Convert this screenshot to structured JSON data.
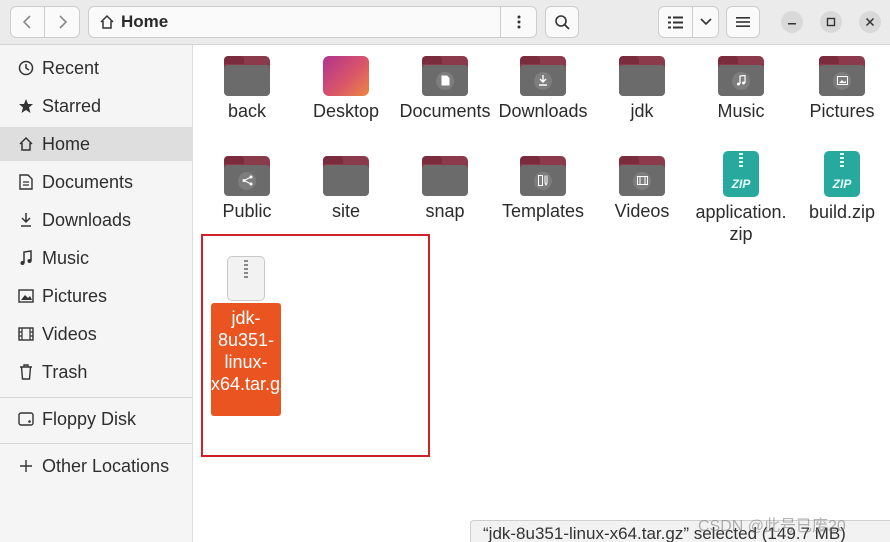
{
  "header": {
    "back_icon": "chevron-left-icon",
    "forward_icon": "chevron-right-icon",
    "path_icon": "home-icon",
    "path_label": "Home",
    "path_menu_icon": "vertical-dots-icon",
    "search_icon": "search-icon",
    "view_icon": "list-view-icon",
    "view_options_icon": "chevron-down-icon",
    "menu_icon": "hamburger-icon",
    "window_buttons": [
      "minimize-icon",
      "maximize-icon",
      "close-icon"
    ]
  },
  "sidebar": {
    "items": [
      {
        "label": "Recent",
        "icon": "clock-icon"
      },
      {
        "label": "Starred",
        "icon": "star-icon"
      },
      {
        "label": "Home",
        "icon": "home-icon",
        "selected": true
      },
      {
        "label": "Documents",
        "icon": "document-icon"
      },
      {
        "label": "Downloads",
        "icon": "download-icon"
      },
      {
        "label": "Music",
        "icon": "music-icon"
      },
      {
        "label": "Pictures",
        "icon": "picture-icon"
      },
      {
        "label": "Videos",
        "icon": "video-icon"
      },
      {
        "label": "Trash",
        "icon": "trash-icon"
      },
      {
        "label": "Floppy Disk",
        "icon": "drive-icon"
      },
      {
        "label": "Other Locations",
        "icon": "plus-icon"
      }
    ]
  },
  "files": [
    {
      "name": "back",
      "type": "folder"
    },
    {
      "name": "Desktop",
      "type": "desktop"
    },
    {
      "name": "Documents",
      "type": "folder",
      "emblem": "document-icon"
    },
    {
      "name": "Downloads",
      "type": "folder",
      "emblem": "download-icon"
    },
    {
      "name": "jdk",
      "type": "folder"
    },
    {
      "name": "Music",
      "type": "folder",
      "emblem": "music-icon"
    },
    {
      "name": "Pictures",
      "type": "folder",
      "emblem": "picture-icon"
    },
    {
      "name": "Public",
      "type": "folder",
      "emblem": "share-icon"
    },
    {
      "name": "site",
      "type": "folder"
    },
    {
      "name": "snap",
      "type": "folder"
    },
    {
      "name": "Templates",
      "type": "folder",
      "emblem": "template-icon"
    },
    {
      "name": "Videos",
      "type": "folder",
      "emblem": "video-icon"
    },
    {
      "name": "application.zip",
      "type": "zip"
    },
    {
      "name": "build.zip",
      "type": "zip"
    }
  ],
  "zip_badge": "ZIP",
  "selected_file": {
    "name": "jdk-8u351-linux-x64.tar.gz",
    "icon": "archive-icon"
  },
  "status_text": "“jdk-8u351-linux-x64.tar.gz” selected (149.7 MB)",
  "watermark": "CSDN @此号已废20",
  "colors": {
    "accent": "#e95420",
    "folder_back": "#8a3a4a",
    "folder_front": "#6b6b6b",
    "zip": "#27a99d",
    "highlight_box": "#d0202a"
  }
}
